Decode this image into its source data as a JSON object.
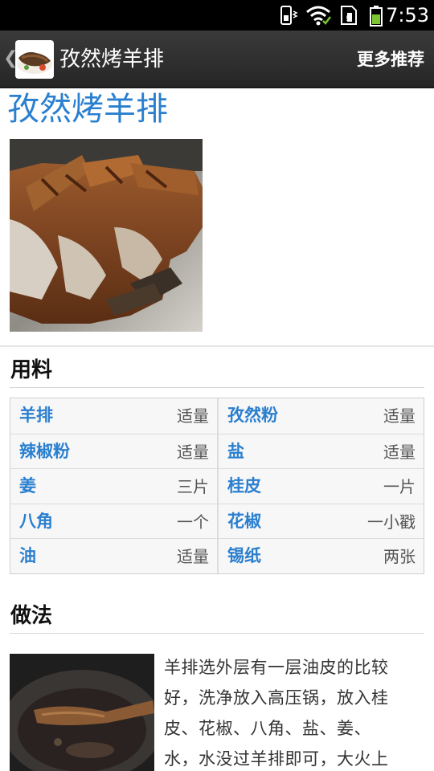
{
  "status_bar": {
    "time": "7:53",
    "icons": [
      "phone-vibrate-icon",
      "wifi-icon",
      "sim-card-icon",
      "battery-icon"
    ]
  },
  "action_bar": {
    "back_icon": "chevron-left-icon",
    "title": "孜然烤羊排",
    "more_label": "更多推荐"
  },
  "recipe": {
    "title": "孜然烤羊排"
  },
  "ingredients": {
    "heading": "用料",
    "rows": [
      [
        {
          "name": "羊排",
          "qty": "适量"
        },
        {
          "name": "孜然粉",
          "qty": "适量"
        }
      ],
      [
        {
          "name": "辣椒粉",
          "qty": "适量"
        },
        {
          "name": "盐",
          "qty": "适量"
        }
      ],
      [
        {
          "name": "姜",
          "qty": "三片"
        },
        {
          "name": "桂皮",
          "qty": "一片"
        }
      ],
      [
        {
          "name": "八角",
          "qty": "一个"
        },
        {
          "name": "花椒",
          "qty": "一小戳"
        }
      ],
      [
        {
          "name": "油",
          "qty": "适量"
        },
        {
          "name": "锡纸",
          "qty": "两张"
        }
      ]
    ]
  },
  "method": {
    "heading": "做法",
    "step1_lines": [
      "羊排选外层有一层油皮的比较",
      "好，洗净放入高压锅，放入桂",
      "皮、花椒、八角、盐、姜、",
      "水，水没过羊排即可，大火上"
    ]
  }
}
